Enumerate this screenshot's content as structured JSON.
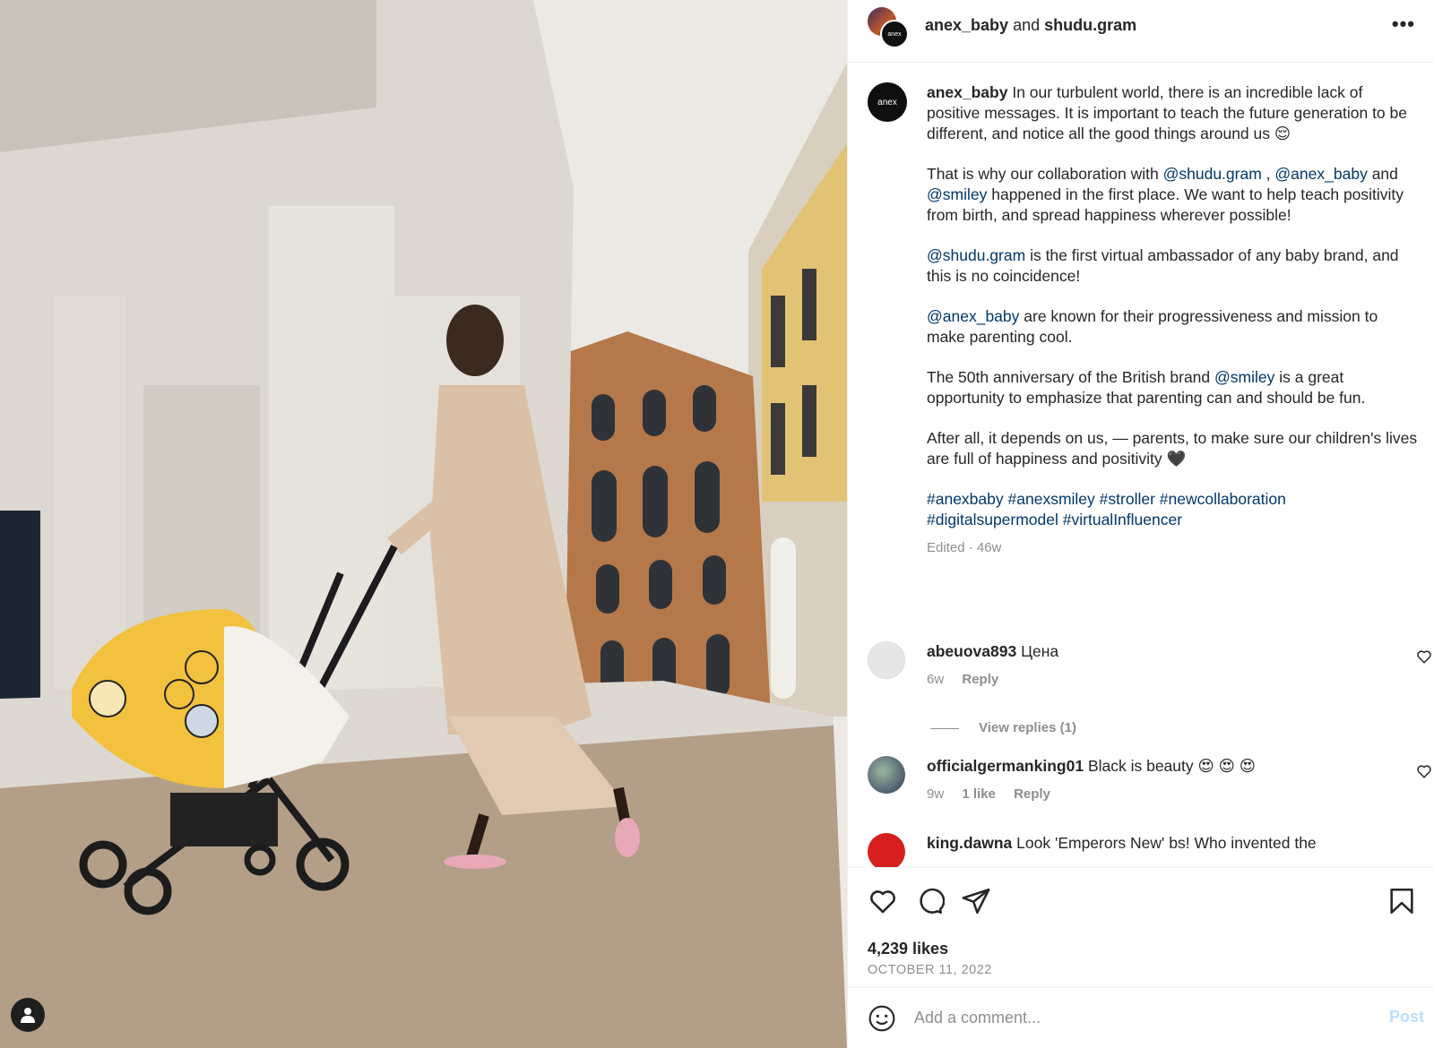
{
  "header": {
    "user1": "anex_baby",
    "joiner": "and",
    "user2": "shudu.gram",
    "avatar_label": "anex",
    "more_icon": "more-horizontal-icon"
  },
  "caption": {
    "avatar_label": "anex",
    "username": "anex_baby",
    "p1_text": "In our turbulent world, there is an incredible lack of positive messages. It is important to teach the future generation to be different, and notice all the good things around us",
    "p1_emoji": "😌",
    "p2_a": "That is why our collaboration with",
    "p2_m1": "@shudu.gram",
    "p2_b": ",",
    "p2_m2": "@anex_baby",
    "p2_c": "and",
    "p2_m3": "@smiley",
    "p2_d": "happened in the first place. We want to help teach positivity from birth, and spread happiness wherever possible!",
    "p3_m": "@shudu.gram",
    "p3_text": "is the first virtual ambassador of any baby brand, and this is no coincidence!",
    "p4_m": "@anex_baby",
    "p4_text": "are known for their progressiveness and mission to make parenting cool.",
    "p5_a": "The 50th anniversary of the British brand",
    "p5_m": "@smiley",
    "p5_b": "is a great opportunity to emphasize that parenting can and should be fun.",
    "p6_text": "After all, it depends on us, — parents, to make sure our children's lives are full of happiness and positivity",
    "p6_emoji": "🖤",
    "hashtags": [
      "#anexbaby",
      "#anexsmiley",
      "#stroller",
      "#newcollaboration",
      "#digitalsupermodel",
      "#virtualInfluencer"
    ],
    "meta": "Edited · 46w"
  },
  "comments": [
    {
      "username": "abeuova893",
      "text": "Цена",
      "age": "6w",
      "likes": "",
      "reply_label": "Reply",
      "view_replies": "View replies (1)"
    },
    {
      "username": "officialgermanking01",
      "text": "Black is beauty 😍 😍 😍",
      "age": "9w",
      "likes": "1 like",
      "reply_label": "Reply"
    },
    {
      "username": "king.dawna",
      "text": "Look 'Emperors New' bs! Who invented the"
    }
  ],
  "actions": {
    "like_icon": "heart-icon",
    "comment_icon": "comment-icon",
    "share_icon": "paper-plane-icon",
    "save_icon": "bookmark-icon",
    "likes": "4,239 likes",
    "date": "OCTOBER 11, 2022"
  },
  "add_comment": {
    "placeholder": "Add a comment...",
    "post_label": "Post",
    "post_color": "#b9dffc"
  },
  "colors": {
    "mention": "#00376b",
    "muted": "#8e8e8e",
    "text": "#262626"
  }
}
